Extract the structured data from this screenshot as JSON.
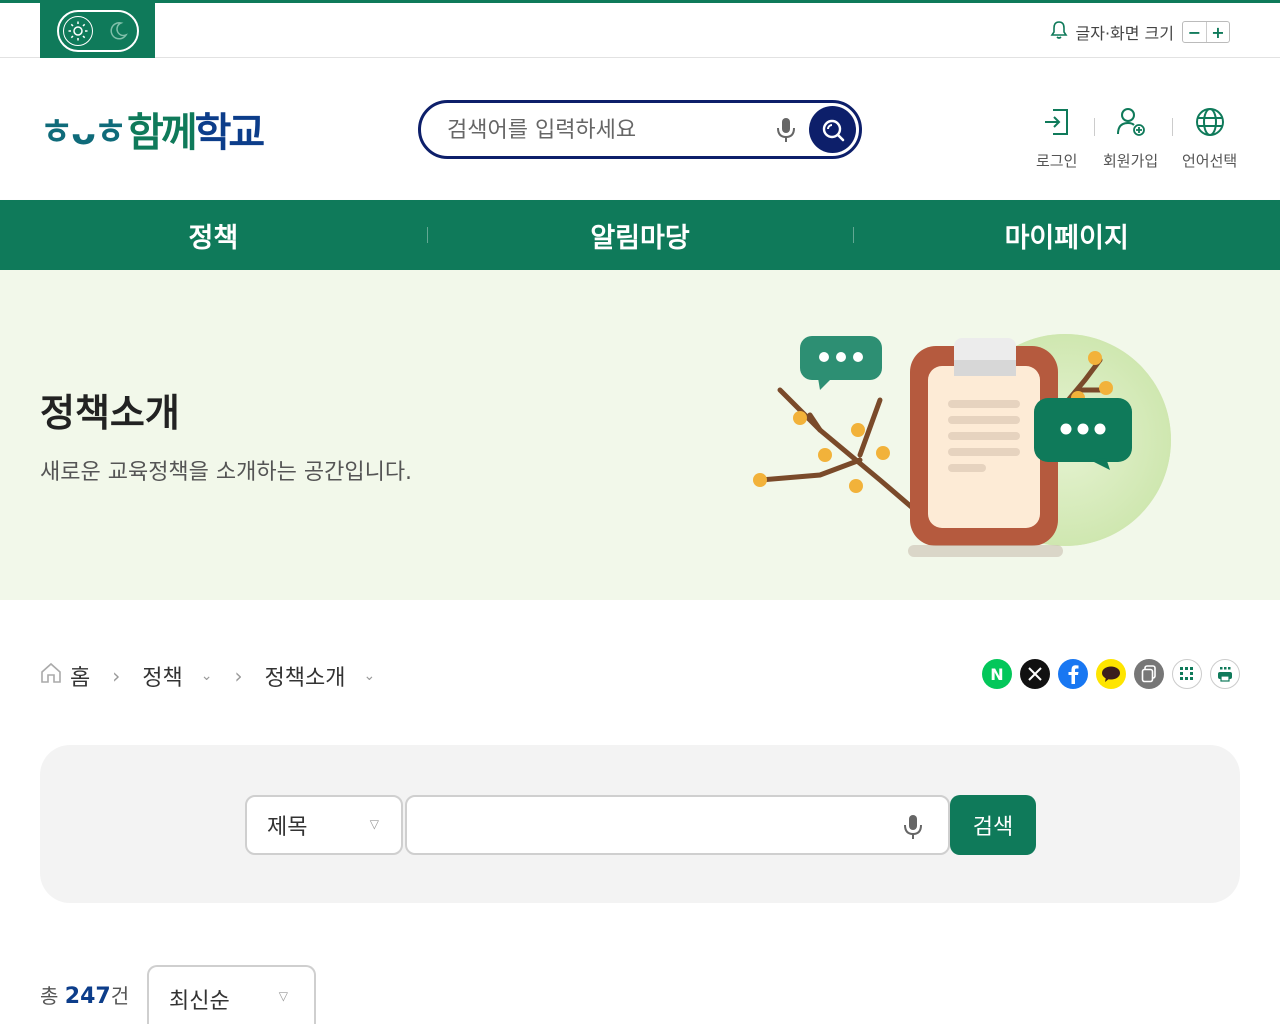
{
  "topbar": {
    "font_size_label": "글자·화면 크기",
    "decrease": "−",
    "increase": "+"
  },
  "logo": {
    "mark": "ㅎᴗㅎ",
    "name_part1": "함께",
    "name_part2": "학교"
  },
  "search": {
    "placeholder": "검색어를 입력하세요"
  },
  "util": {
    "login": "로그인",
    "signup": "회원가입",
    "language": "언어선택"
  },
  "nav": {
    "items": [
      "정책",
      "알림마당",
      "마이페이지"
    ]
  },
  "hero": {
    "title": "정책소개",
    "subtitle": "새로운 교육정책을 소개하는 공간입니다."
  },
  "breadcrumb": {
    "home": "홈",
    "level1": "정책",
    "level2": "정책소개"
  },
  "share": {
    "icons": [
      "naver-icon",
      "x-icon",
      "facebook-icon",
      "kakaotalk-icon",
      "copy-link-icon",
      "qr-code-icon",
      "print-icon"
    ],
    "naver_letter": "N"
  },
  "search_panel": {
    "select_value": "제목",
    "button_label": "검색"
  },
  "list": {
    "total_prefix": "총 ",
    "total_count": "247",
    "total_suffix": "건",
    "sort_value": "최신순"
  },
  "colors": {
    "brand_green": "#0f7a5a",
    "brand_navy": "#0d1f6a",
    "hero_bg": "#f2f8ea"
  }
}
